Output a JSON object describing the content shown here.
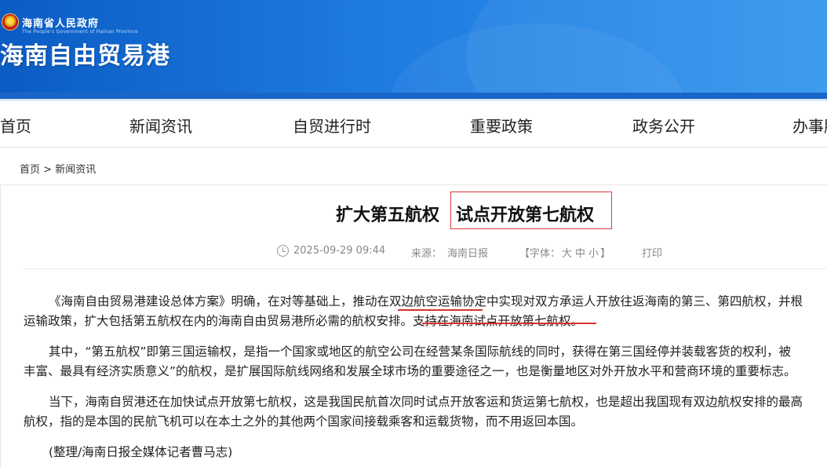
{
  "header": {
    "gov_name": "海南省人民政府",
    "gov_sub": "The People's Government of Hainan Province",
    "site_title": "海南自由贸易港"
  },
  "nav": {
    "items": [
      {
        "label": "首页"
      },
      {
        "label": "新闻资讯"
      },
      {
        "label": "自贸进行时"
      },
      {
        "label": "重要政策"
      },
      {
        "label": "政务公开"
      },
      {
        "label": "办事服"
      }
    ]
  },
  "breadcrumb": {
    "home": "首页",
    "separator": ">",
    "current": "新闻资讯"
  },
  "article": {
    "title_part1": "扩大第五航权",
    "title_part2": "试点开放第七航权",
    "date": "2025-09-29 09:44",
    "source_label": "来源：",
    "source": "海南日报",
    "font_label": "【字体：",
    "font_sizes": [
      "大",
      "中",
      "小"
    ],
    "font_close": "】",
    "print": "打印",
    "paragraphs": {
      "p1a": "《海南自由贸易港建设总体方案》明确，在对等基础上，推动在双边航空运输协定中实现对双方承运人开放往返海南的第三、第四航权，并根",
      "p1b": "运输政策，扩大包括第五航权在内的海南自由贸易港所必需的航权安排。支持在海南试点开放第七航权。",
      "p2a": "其中，“第五航权”即第三国运输权，是指一个国家或地区的航空公司在经营某条国际航线的同时，获得在第三国经停并装载客货的权利，被",
      "p2b": "丰富、最具有经济实质意义”的航权，是扩展国际航线网络和发展全球市场的重要途径之一，也是衡量地区对外开放水平和营商环境的重要标志。",
      "p3a": "当下，海南自贸港还在加快试点开放第七航权，这是我国民航首次同时试点开放客运和货运第七航权，也是超出我国现有双边航权安排的最高",
      "p3b": "航权，指的是本国的民航飞机可以在本土之外的其他两个国家间接载乘客和运载货物，而不用返回本国。",
      "p4": "(整理/海南日报全媒体记者曹马志)"
    }
  }
}
